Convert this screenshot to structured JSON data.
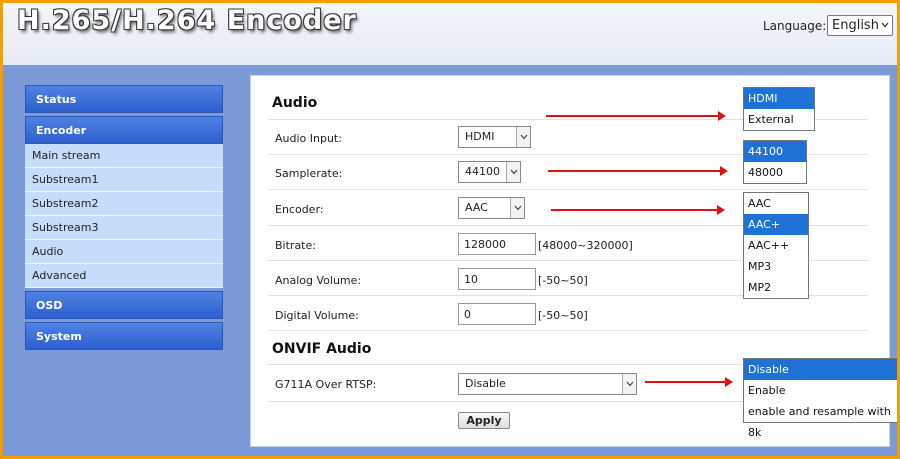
{
  "header": {
    "title": "H.265/H.264 Encoder",
    "language_label": "Language:",
    "language_value": "English"
  },
  "sidebar": {
    "status": "Status",
    "encoder": "Encoder",
    "items": [
      "Main stream",
      "Substream1",
      "Substream2",
      "Substream3",
      "Audio",
      "Advanced"
    ],
    "osd": "OSD",
    "system": "System"
  },
  "audio": {
    "title": "Audio",
    "input_label": "Audio Input:",
    "input_value": "HDMI",
    "samplerate_label": "Samplerate:",
    "samplerate_value": "44100",
    "encoder_label": "Encoder:",
    "encoder_value": "AAC",
    "bitrate_label": "Bitrate:",
    "bitrate_value": "128000",
    "bitrate_range": "[48000~320000]",
    "analog_label": "Analog Volume:",
    "analog_value": "10",
    "analog_range": "[-50~50]",
    "digital_label": "Digital Volume:",
    "digital_value": "0",
    "digital_range": "[-50~50]"
  },
  "onvif": {
    "title": "ONVIF Audio",
    "g711_label": "G711A Over RTSP:",
    "g711_value": "Disable",
    "apply_label": "Apply"
  },
  "popups": {
    "input_options": [
      "HDMI",
      "External"
    ],
    "samplerate_options": [
      "44100",
      "48000"
    ],
    "encoder_options": [
      "AAC",
      "AAC+",
      "AAC++",
      "MP3",
      "MP2"
    ],
    "g711_options": [
      "Disable",
      "Enable",
      "enable and resample with 8k"
    ]
  },
  "colors": {
    "annotation_arrow": "#e21010",
    "highlight": "#1e72d6",
    "frame": "#f0a000"
  }
}
